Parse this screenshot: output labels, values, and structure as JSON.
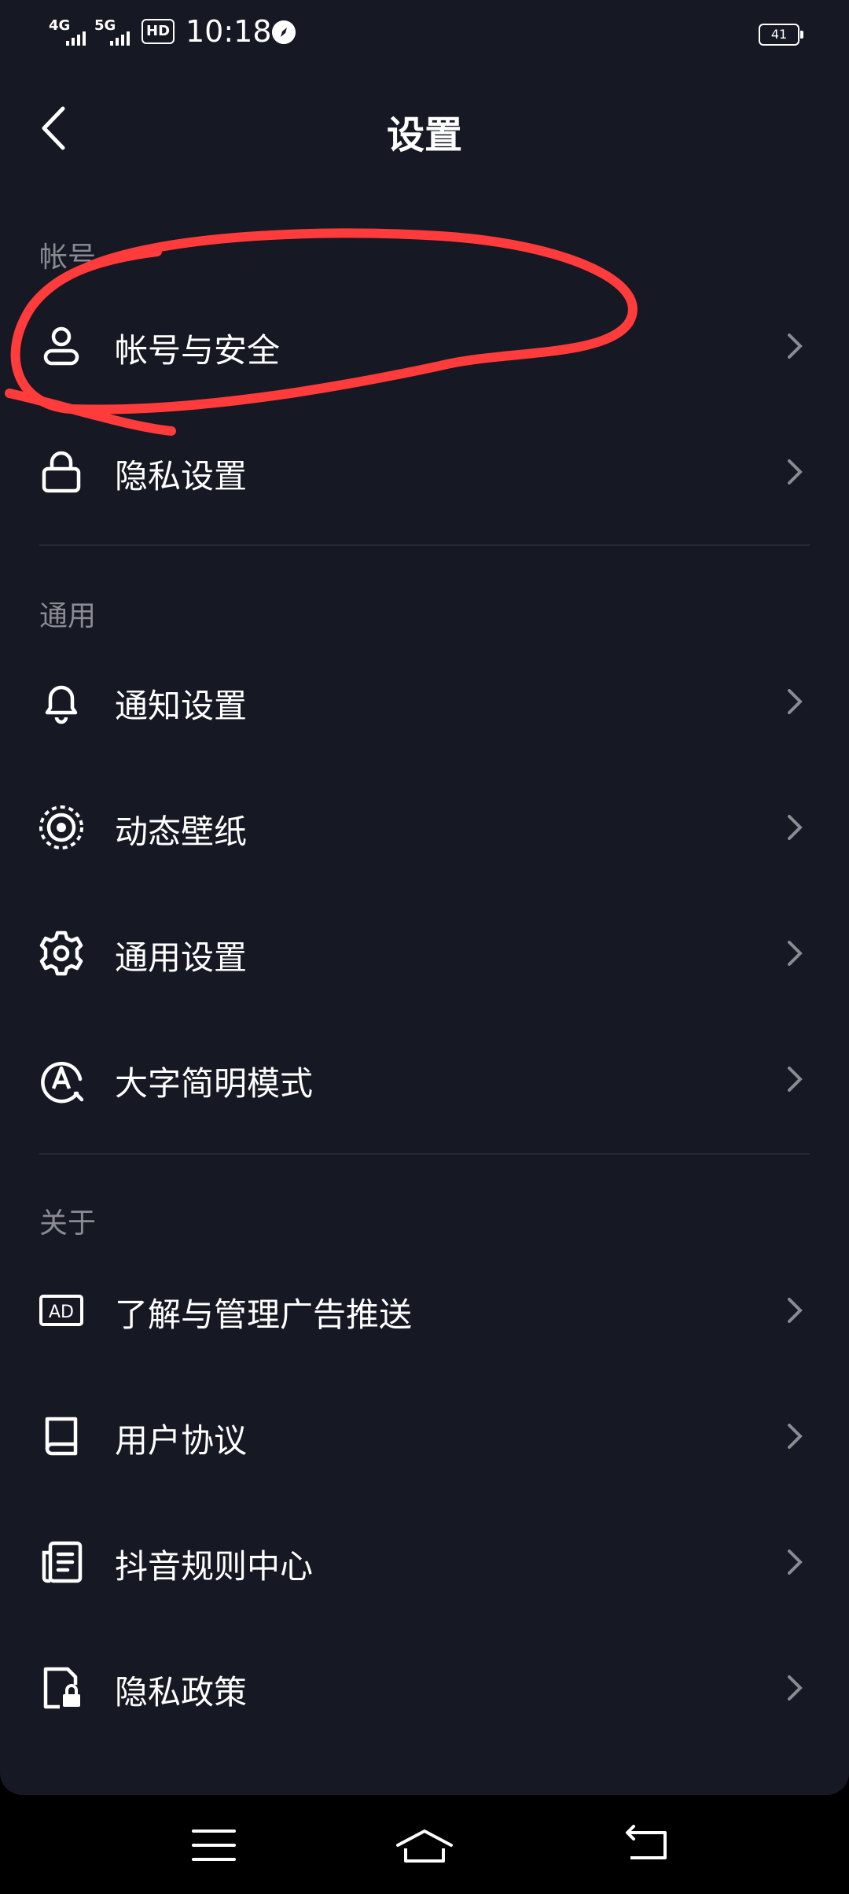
{
  "status_bar": {
    "network1": "4G",
    "network2": "5G",
    "hd": "HD",
    "time": "10:18",
    "battery": "41"
  },
  "header": {
    "title": "设置"
  },
  "sections": [
    {
      "label": "帐号",
      "items": [
        {
          "label": "帐号与安全",
          "icon": "user-icon"
        },
        {
          "label": "隐私设置",
          "icon": "lock-icon"
        }
      ]
    },
    {
      "label": "通用",
      "items": [
        {
          "label": "通知设置",
          "icon": "bell-icon"
        },
        {
          "label": "动态壁纸",
          "icon": "wallpaper-icon"
        },
        {
          "label": "通用设置",
          "icon": "gear-icon"
        },
        {
          "label": "大字简明模式",
          "icon": "font-size-icon"
        }
      ]
    },
    {
      "label": "关于",
      "items": [
        {
          "label": "了解与管理广告推送",
          "icon": "ad-icon"
        },
        {
          "label": "用户协议",
          "icon": "book-icon"
        },
        {
          "label": "抖音规则中心",
          "icon": "document-icon"
        },
        {
          "label": "隐私政策",
          "icon": "privacy-policy-icon"
        }
      ]
    }
  ],
  "colors": {
    "background": "#161823",
    "annotation": "#ff3b3b",
    "section_label": "#8a8b93"
  }
}
